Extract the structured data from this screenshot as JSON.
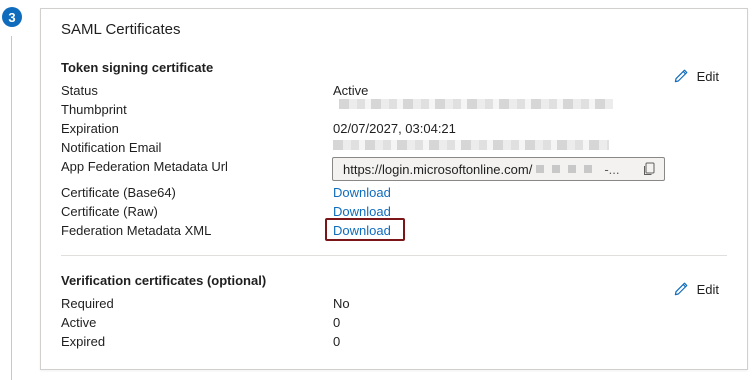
{
  "step": {
    "number": "3"
  },
  "card": {
    "title": "SAML Certificates"
  },
  "token_signing": {
    "title": "Token signing certificate",
    "edit_label": "Edit",
    "rows": {
      "status": {
        "label": "Status",
        "value": "Active"
      },
      "thumbprint": {
        "label": "Thumbprint"
      },
      "expiration": {
        "label": "Expiration",
        "value": "02/07/2027, 03:04:21"
      },
      "notification_email": {
        "label": "Notification Email"
      },
      "metadata_url": {
        "label": "App Federation Metadata Url",
        "value": "https://login.microsoftonline.com/",
        "ellipsis": "-..."
      },
      "cert_base64": {
        "label": "Certificate (Base64)",
        "link": "Download"
      },
      "cert_raw": {
        "label": "Certificate (Raw)",
        "link": "Download"
      },
      "fed_metadata_xml": {
        "label": "Federation Metadata XML",
        "link": "Download"
      }
    }
  },
  "verification": {
    "title": "Verification certificates (optional)",
    "edit_label": "Edit",
    "rows": {
      "required": {
        "label": "Required",
        "value": "No"
      },
      "active": {
        "label": "Active",
        "value": "0"
      },
      "expired": {
        "label": "Expired",
        "value": "0"
      }
    }
  },
  "colors": {
    "accent": "#0f6cbd",
    "highlight": "#7a1518"
  },
  "icons": {
    "edit": "pencil-icon",
    "copy": "copy-icon"
  }
}
